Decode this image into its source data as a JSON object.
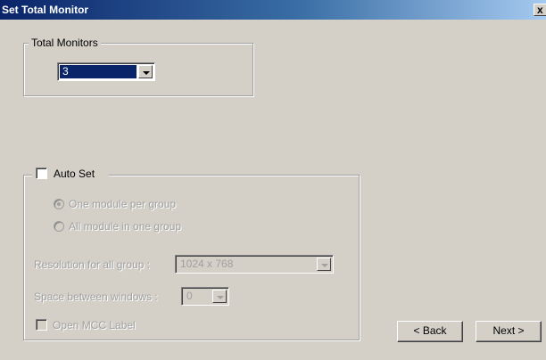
{
  "window": {
    "title": "Set Total Monitor",
    "close_label": "x"
  },
  "total_monitors": {
    "group_label": "Total Monitors",
    "selected_value": "3"
  },
  "auto_set": {
    "label": "Auto Set",
    "checked": false,
    "radio_one_module": "One module per group",
    "radio_all_module": "All module in one group",
    "resolution_label": "Resolution for all group :",
    "resolution_value": "1024 x 768",
    "space_label": "Space between windows :",
    "space_value": "0",
    "open_mcc_label": "Open MCC Label"
  },
  "buttons": {
    "back": "< Back",
    "next": "Next >"
  },
  "colors": {
    "title_bar_start": "#0a246a",
    "face": "#d4d0c8",
    "selection": "#0a246a",
    "disabled_text": "#a0a0a0"
  }
}
